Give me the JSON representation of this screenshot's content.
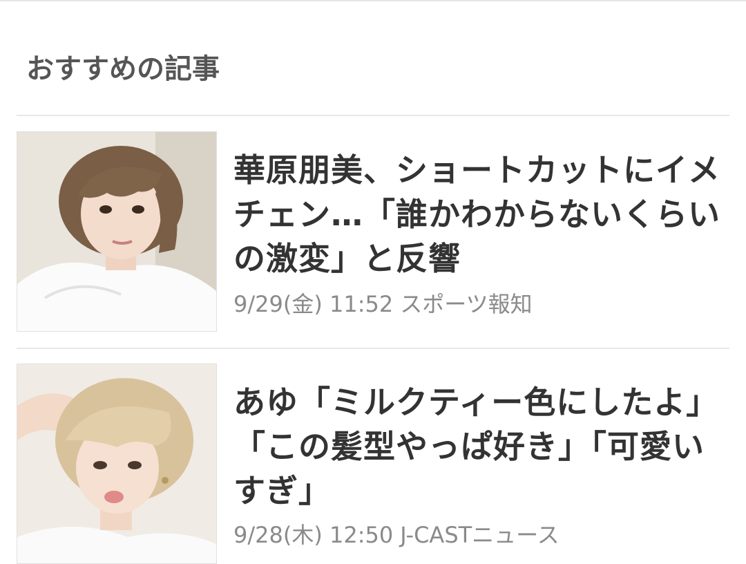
{
  "section": {
    "title": "おすすめの記事"
  },
  "articles": [
    {
      "headline": "華原朋美、ショートカットにイメチェン…「誰かわからないくらいの激変」と反響",
      "date": "9/29(金) 11:52",
      "source": "スポーツ報知",
      "thumbnail_icon": "woman-short-brown-hair-photo"
    },
    {
      "headline": "あゆ「ミルクティー色にしたよ」「この髪型やっぱ好き」「可愛いすぎ」",
      "date": "9/28(木) 12:50",
      "source": "J-CASTニュース",
      "thumbnail_icon": "woman-short-blonde-hair-photo"
    }
  ]
}
